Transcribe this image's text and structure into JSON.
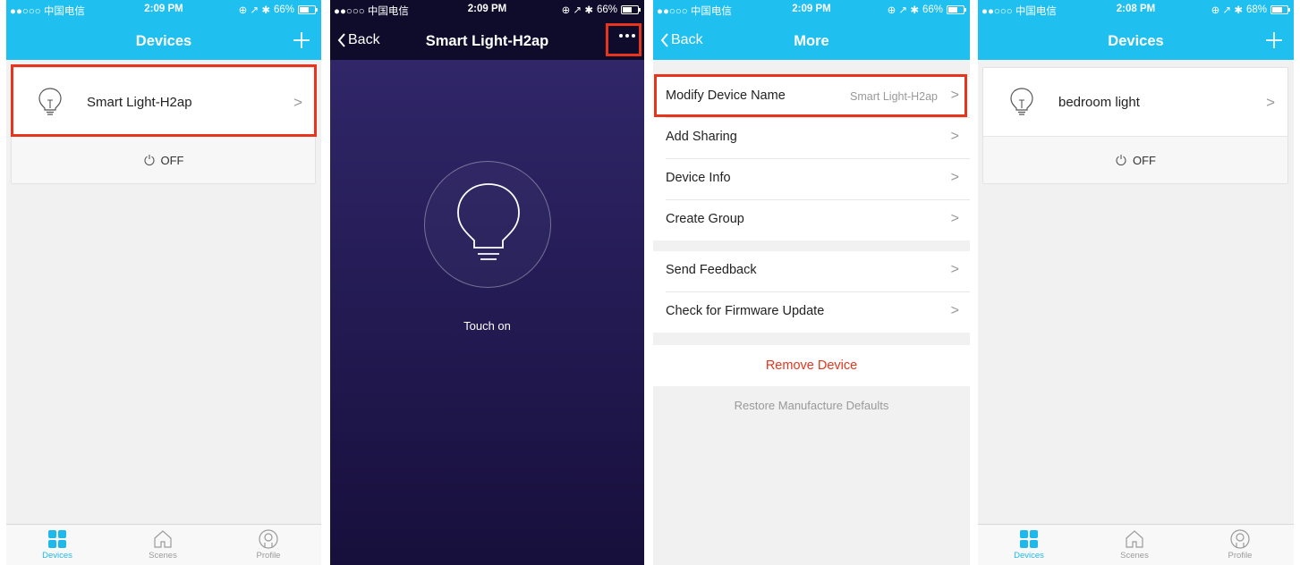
{
  "status_bars": [
    {
      "carrier": "●●○○○ 中国电信 ",
      "time": "2:09 PM",
      "battery": "66%",
      "battery_level": 0.66
    },
    {
      "carrier": "●●○○○ 中国电信 ",
      "time": "2:09 PM",
      "battery": "66%",
      "battery_level": 0.66
    },
    {
      "carrier": "●●○○○ 中国电信 ",
      "time": "2:09 PM",
      "battery": "66%",
      "battery_level": 0.66
    },
    {
      "carrier": "●●○○○ 中国电信 ",
      "time": "2:08 PM",
      "battery": "68%",
      "battery_level": 0.68
    }
  ],
  "screen1": {
    "title": "Devices",
    "device_name": "Smart Light-H2ap",
    "power_label": "OFF"
  },
  "screen2": {
    "back_label": "Back",
    "title": "Smart Light-H2ap",
    "touch_label": "Touch on"
  },
  "screen3": {
    "back_label": "Back",
    "title": "More",
    "group1": [
      {
        "label": "Modify Device Name",
        "value": "Smart Light-H2ap"
      },
      {
        "label": "Add Sharing",
        "value": ""
      },
      {
        "label": "Device Info",
        "value": ""
      },
      {
        "label": "Create Group",
        "value": ""
      }
    ],
    "group2": [
      {
        "label": "Send Feedback",
        "value": ""
      },
      {
        "label": "Check for Firmware Update",
        "value": ""
      }
    ],
    "remove_label": "Remove Device",
    "restore_label": "Restore Manufacture Defaults"
  },
  "screen4": {
    "title": "Devices",
    "device_name": "bedroom light",
    "power_label": "OFF"
  },
  "tabbar": {
    "devices": "Devices",
    "scenes": "Scenes",
    "profile": "Profile"
  },
  "colors": {
    "accent": "#1fc0ef",
    "highlight": "#e8341c",
    "danger": "#e8341c"
  }
}
